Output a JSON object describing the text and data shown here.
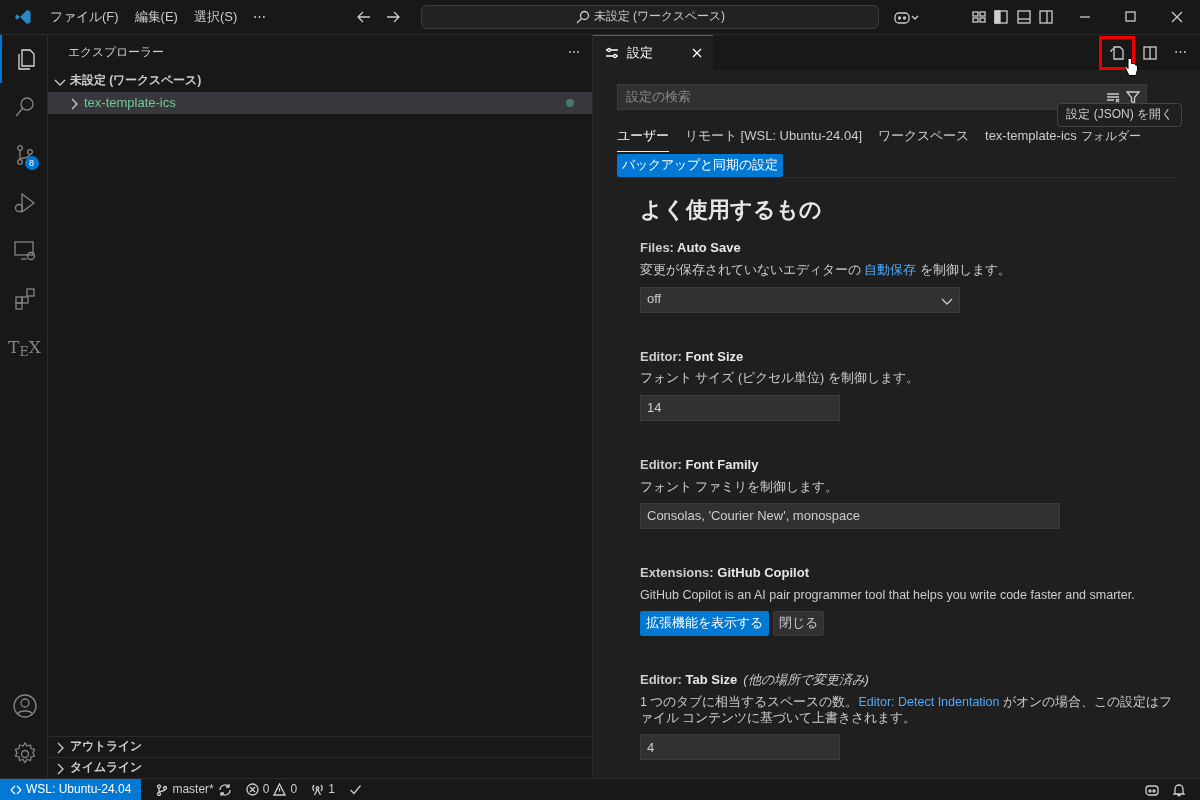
{
  "title_bar": {
    "menus": [
      "ファイル(F)",
      "編集(E)",
      "選択(S)"
    ],
    "overflow": "⋯",
    "command_center": "未設定 (ワークスペース)"
  },
  "activity_bar": [
    {
      "kind": "explorer",
      "selected": true
    },
    {
      "kind": "search",
      "selected": false
    },
    {
      "kind": "scm",
      "selected": false,
      "badge": "8"
    },
    {
      "kind": "debug",
      "selected": false
    },
    {
      "kind": "remote",
      "selected": false
    },
    {
      "kind": "extensions",
      "selected": false
    },
    {
      "kind": "tex",
      "selected": false,
      "label": "T$_{E}$X"
    }
  ],
  "sidebar": {
    "title": "エクスプローラー",
    "more": "⋯",
    "workspace": {
      "label": "未設定 (ワークスペース)",
      "expanded": true,
      "items": [
        {
          "label": "tex-template-ics",
          "expanded": false,
          "selected": true
        }
      ]
    },
    "sections": [
      {
        "label": "アウトライン",
        "expanded": false
      },
      {
        "label": "タイムライン",
        "expanded": false
      }
    ]
  },
  "editor": {
    "tabs": [
      {
        "label": "設定",
        "selected": true
      }
    ],
    "tooltip": "設定 (JSON) を開く",
    "more": "⋯",
    "search": {
      "placeholder": "設定の検索"
    },
    "scopes": [
      {
        "label": "ユーザー",
        "selected": true
      },
      {
        "label": "リモート [WSL: Ubuntu-24.04]",
        "selected": false
      },
      {
        "label": "ワークスペース",
        "selected": false
      },
      {
        "label": "tex-template-ics",
        "suffix": "フォルダー",
        "selected": false
      }
    ],
    "sync_button": "バックアップと同期の設定",
    "heading": "よく使用するもの",
    "settings": [
      {
        "kind": "select",
        "category": "Files:",
        "name": "Auto Save",
        "description": [
          {
            "text": "変更が保存されていないエディターの ",
            "link": false
          },
          {
            "text": "自動保存",
            "link": true
          },
          {
            "text": " を制御します。",
            "link": false
          }
        ],
        "value": "off"
      },
      {
        "kind": "input",
        "category": "Editor:",
        "name": "Font Size",
        "description": [
          {
            "text": "フォント サイズ (ピクセル単位) を制御します。",
            "link": false
          }
        ],
        "value": "14"
      },
      {
        "kind": "wide-input",
        "category": "Editor:",
        "name": "Font Family",
        "description": [
          {
            "text": "フォント ファミリを制御します。",
            "link": false
          }
        ],
        "value": "Consolas, 'Courier New', monospace"
      },
      {
        "kind": "extension",
        "category": "Extensions:",
        "name": "GitHub Copilot",
        "description": [
          {
            "text": "GitHub Copilot is an AI pair programmer tool that helps you write code faster and smarter.",
            "link": false
          }
        ],
        "buttons": [
          {
            "label": "拡張機能を表示する",
            "primary": true
          },
          {
            "label": "閉じる",
            "primary": false
          }
        ]
      },
      {
        "kind": "input",
        "category": "Editor:",
        "name": "Tab Size",
        "note": "(他の場所で変更済み)",
        "description": [
          {
            "text": "1 つのタブに相当するスペースの数。",
            "link": false
          },
          {
            "text": "Editor: Detect Indentation",
            "link": true
          },
          {
            "text": " がオンの場合、この設定はファイル コンテンツに基づいて上書きされます。",
            "link": false
          }
        ],
        "value": "4"
      }
    ]
  },
  "status_bar": {
    "remote": "WSL: Ubuntu-24.04",
    "branch": "master*",
    "errors": "0",
    "warnings": "0",
    "ports": "1"
  }
}
